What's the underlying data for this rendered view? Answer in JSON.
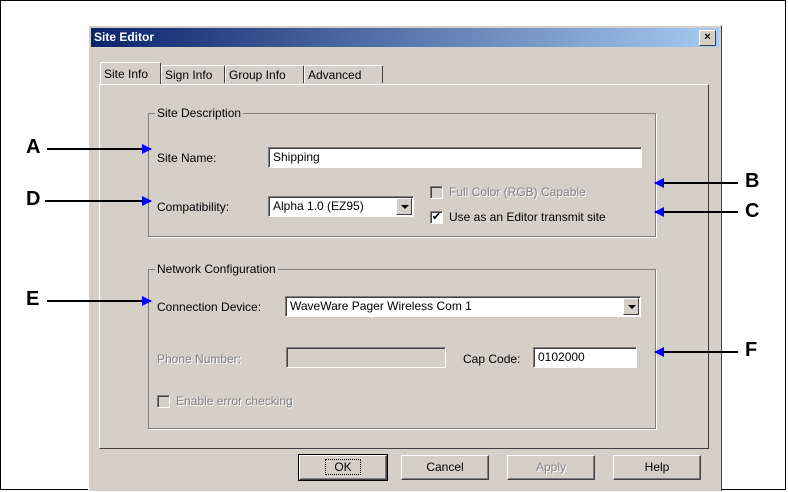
{
  "window": {
    "title": "Site Editor",
    "close_glyph": "×"
  },
  "tabs": [
    {
      "label": "Site Info",
      "active": true
    },
    {
      "label": "Sign Info",
      "active": false
    },
    {
      "label": "Group Info",
      "active": false
    },
    {
      "label": "Advanced",
      "active": false
    }
  ],
  "site_description": {
    "legend": "Site Description",
    "site_name_label": "Site Name:",
    "site_name_value": "Shipping",
    "compatibility_label": "Compatibility:",
    "compatibility_value": "Alpha 1.0 (EZ95)",
    "full_color_label": "Full Color (RGB) Capable",
    "full_color_checked": false,
    "transmit_label": "Use as an Editor transmit site",
    "transmit_checked": true,
    "checkmark": "✔"
  },
  "network": {
    "legend": "Network Configuration",
    "connection_label": "Connection Device:",
    "connection_value": "WaveWare Pager Wireless Com 1",
    "phone_label": "Phone Number:",
    "phone_value": "",
    "cap_code_label": "Cap Code:",
    "cap_code_value": "0102000",
    "error_check_label": "Enable error checking",
    "error_check_checked": false
  },
  "buttons": {
    "ok": "OK",
    "cancel": "Cancel",
    "apply": "Apply",
    "help": "Help"
  },
  "callouts": {
    "a": "A",
    "b": "B",
    "c": "C",
    "d": "D",
    "e": "E",
    "f": "F"
  },
  "colors": {
    "arrow": "#0000ff",
    "titlebar_start": "#0a246a",
    "face": "#d4d0c8"
  }
}
